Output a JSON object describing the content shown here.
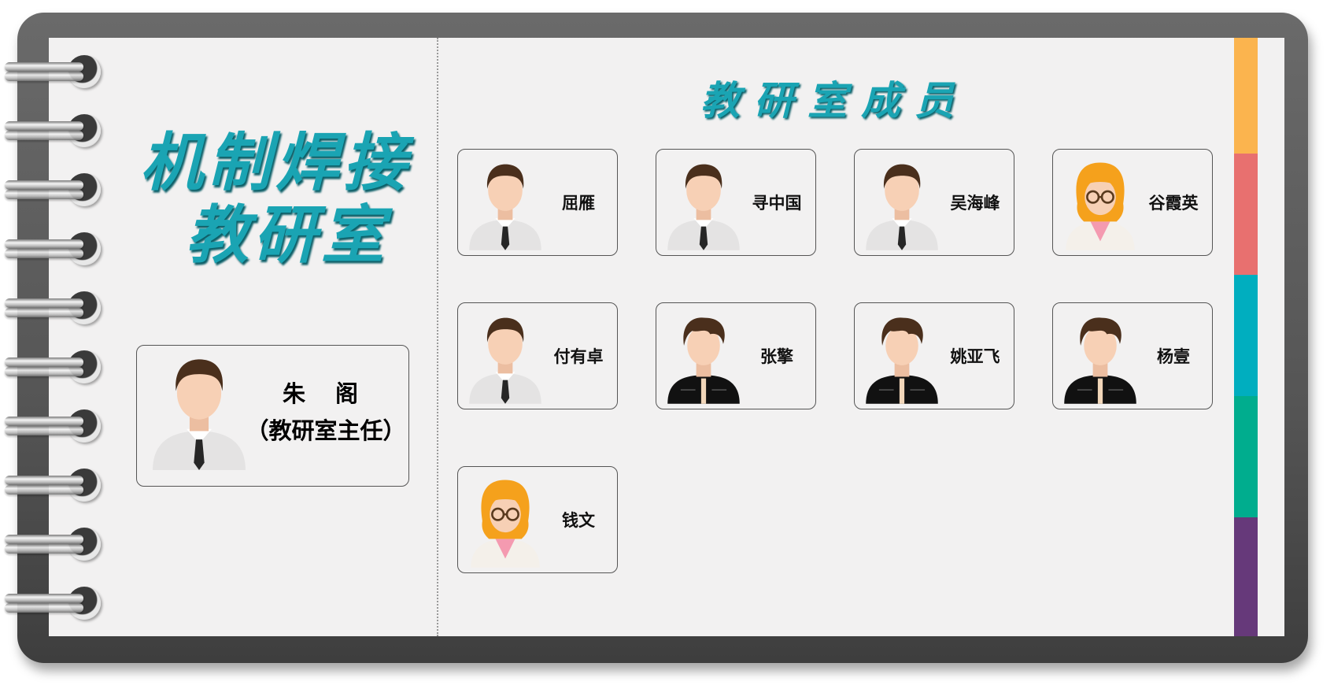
{
  "department_title": [
    "机制焊接",
    "教研室"
  ],
  "members_title": "教研室成员",
  "director": {
    "name": "朱 阁",
    "role": "（教研室主任）",
    "avatar": "male-shirt-tie"
  },
  "members": [
    {
      "name": "屈雁",
      "avatar": "male-shirt-tie"
    },
    {
      "name": "寻中国",
      "avatar": "male-shirt-tie"
    },
    {
      "name": "吴海峰",
      "avatar": "male-shirt-tie"
    },
    {
      "name": "谷霞英",
      "avatar": "female-glasses"
    },
    {
      "name": "付有卓",
      "avatar": "male-shirt-tie"
    },
    {
      "name": "张擎",
      "avatar": "male-black-jacket"
    },
    {
      "name": "姚亚飞",
      "avatar": "male-black-jacket"
    },
    {
      "name": "杨壹",
      "avatar": "male-black-jacket"
    },
    {
      "name": "钱文",
      "avatar": "female-glasses"
    }
  ],
  "colors": {
    "title": "#1aa4b3",
    "tabs": [
      "#fbb44e",
      "#e8706f",
      "#00aebf",
      "#00ad8e",
      "#66397a"
    ]
  }
}
